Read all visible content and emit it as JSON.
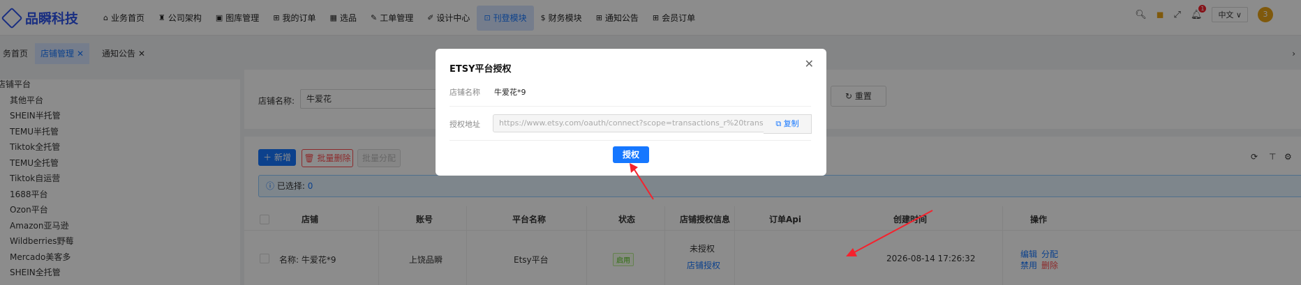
{
  "app": {
    "name": "品瞬科技"
  },
  "nav": [
    {
      "label": "业务首页",
      "icon": "home-icon",
      "glyph": "⌂"
    },
    {
      "label": "公司架构",
      "icon": "org-icon",
      "glyph": "♜"
    },
    {
      "label": "图库管理",
      "icon": "image-icon",
      "glyph": "▣"
    },
    {
      "label": "我的订单",
      "icon": "grid-icon",
      "glyph": "⊞"
    },
    {
      "label": "选品",
      "icon": "table-icon",
      "glyph": "▦"
    },
    {
      "label": "工单管理",
      "icon": "edit-icon",
      "glyph": "✎"
    },
    {
      "label": "设计中心",
      "icon": "design-icon",
      "glyph": "✐"
    },
    {
      "label": "刊登模块",
      "icon": "publish-icon",
      "glyph": "⊡"
    },
    {
      "label": "财务模块",
      "icon": "finance-icon",
      "glyph": "$"
    },
    {
      "label": "通知公告",
      "icon": "notice-icon",
      "glyph": "⊞"
    },
    {
      "label": "会员订单",
      "icon": "member-icon",
      "glyph": "⊞"
    }
  ],
  "toolbar": {
    "badge_count": "1",
    "language": "中文",
    "avatar_text": "3"
  },
  "tabs": [
    "务首页",
    "店铺管理",
    "通知公告"
  ],
  "sidebar": [
    "店铺平台",
    "其他平台",
    "SHEIN半托管",
    "TEMU半托管",
    "Tiktok全托管",
    "TEMU全托管",
    "Tiktok自运营",
    "1688平台",
    "Ozon平台",
    "Amazon亚马逊",
    "Wildberries野莓",
    "Mercado美客多",
    "SHEIN全托管"
  ],
  "filter": {
    "label": "店铺名称:",
    "value": "牛爱花",
    "reset": "重置"
  },
  "actions": {
    "add": "新增",
    "batch_delete": "批量删除",
    "batch_assign": "批量分配"
  },
  "selection": {
    "text": "已选择:",
    "count": "0"
  },
  "table": {
    "headers": [
      "店铺",
      "账号",
      "平台名称",
      "状态",
      "店铺授权信息",
      "订单Api",
      "创建时间",
      "操作"
    ],
    "row": {
      "shop": "名称: 牛爱花*9",
      "account": "上饶品瞬",
      "platform": "Etsy平台",
      "status": "启用",
      "auth_status": "未授权",
      "auth_link": "店铺授权",
      "created": "2026-08-14 17:26:32",
      "op_edit": "编辑",
      "op_assign": "分配",
      "op_disable": "禁用",
      "op_delete": "删除"
    }
  },
  "modal": {
    "title": "ETSY平台授权",
    "shop_label": "店铺名称",
    "shop_value": "牛爱花*9",
    "url_label": "授权地址",
    "url_value": "https://www.etsy.com/oauth/connect?scope=transactions_r%20transactions_w",
    "copy": "复制",
    "authorize": "授权"
  }
}
